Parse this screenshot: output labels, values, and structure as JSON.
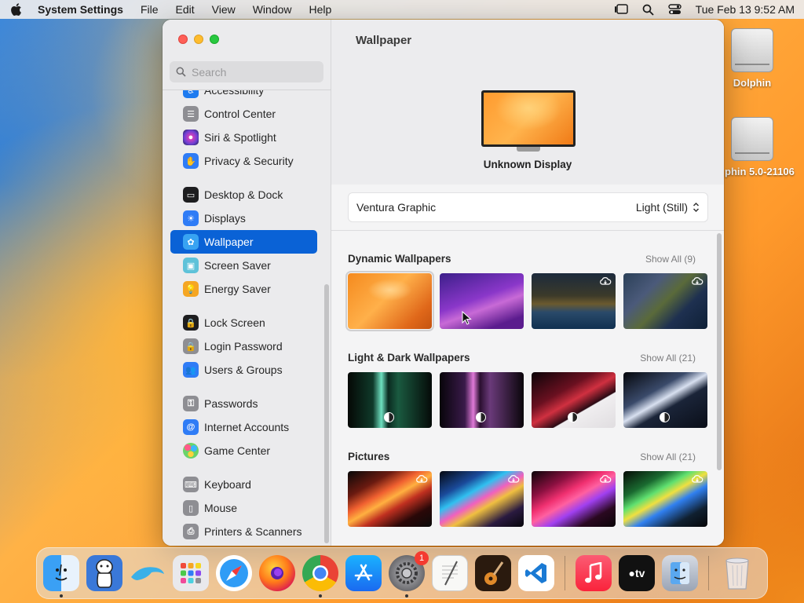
{
  "menubar": {
    "app_name": "System Settings",
    "menus": [
      "File",
      "Edit",
      "View",
      "Window",
      "Help"
    ],
    "clock": "Tue Feb 13  9:52 AM"
  },
  "desktop": {
    "icons": [
      {
        "label": "Dolphin"
      },
      {
        "label": "phin 5.0-21106"
      }
    ]
  },
  "sidebar": {
    "search_placeholder": "Search",
    "items": [
      {
        "label": "Accessibility",
        "icon": "accessibility-icon",
        "color": "#1e7bf0"
      },
      {
        "label": "Control Center",
        "icon": "control-center-icon",
        "color": "#8e8e93"
      },
      {
        "label": "Siri & Spotlight",
        "icon": "siri-icon",
        "color": "#6b3fd4"
      },
      {
        "label": "Privacy & Security",
        "icon": "hand-icon",
        "color": "#2f7cf6"
      },
      {
        "label": "Desktop & Dock",
        "icon": "desktop-dock-icon",
        "color": "#1d1d1f"
      },
      {
        "label": "Displays",
        "icon": "sun-icon",
        "color": "#2f7cf6"
      },
      {
        "label": "Wallpaper",
        "icon": "wallpaper-icon",
        "color": "#38a3f2"
      },
      {
        "label": "Screen Saver",
        "icon": "screen-saver-icon",
        "color": "#5ec2d9"
      },
      {
        "label": "Energy Saver",
        "icon": "bulb-icon",
        "color": "#f5a623"
      },
      {
        "label": "Lock Screen",
        "icon": "lock-icon",
        "color": "#1d1d1f"
      },
      {
        "label": "Login Password",
        "icon": "login-lock-icon",
        "color": "#8e8e93"
      },
      {
        "label": "Users & Groups",
        "icon": "users-icon",
        "color": "#2f7cf6"
      },
      {
        "label": "Passwords",
        "icon": "key-icon",
        "color": "#8e8e93"
      },
      {
        "label": "Internet Accounts",
        "icon": "at-icon",
        "color": "#2f7cf6"
      },
      {
        "label": "Game Center",
        "icon": "game-center-icon",
        "color": "#ffffff"
      },
      {
        "label": "Keyboard",
        "icon": "keyboard-icon",
        "color": "#8e8e93"
      },
      {
        "label": "Mouse",
        "icon": "mouse-icon",
        "color": "#8e8e93"
      },
      {
        "label": "Printers & Scanners",
        "icon": "printer-icon",
        "color": "#8e8e93"
      }
    ],
    "selected": "Wallpaper"
  },
  "content": {
    "title": "Wallpaper",
    "display_name": "Unknown Display",
    "wallpaper_name": "Ventura Graphic",
    "wallpaper_mode": "Light (Still)",
    "sections": [
      {
        "title": "Dynamic Wallpapers",
        "show_all": "Show All (9)"
      },
      {
        "title": "Light & Dark Wallpapers",
        "show_all": "Show All (21)"
      },
      {
        "title": "Pictures",
        "show_all": "Show All (21)"
      }
    ]
  },
  "dock": {
    "apps": [
      "Finder",
      "Mascot",
      "Dolphin",
      "Launchpad",
      "Safari",
      "Firefox",
      "Chrome",
      "App Store",
      "System Settings",
      "TextEdit",
      "GarageBand",
      "VS Code",
      "Music",
      "Apple TV",
      "Preview",
      "Trash"
    ],
    "badge_count": "1"
  }
}
